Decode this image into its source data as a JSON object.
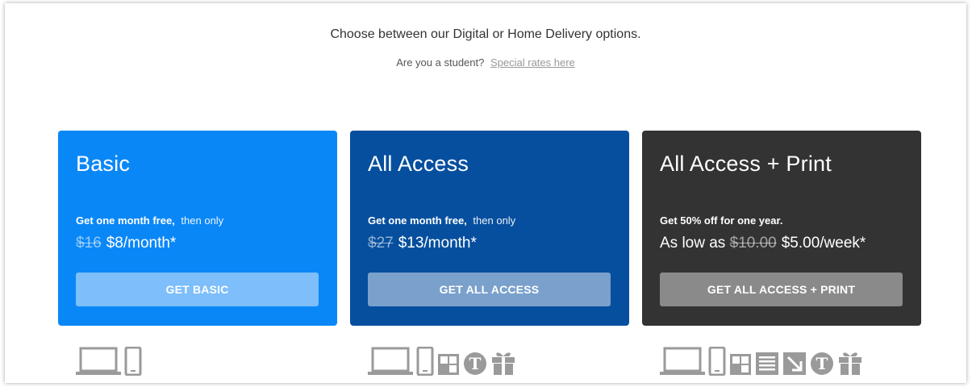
{
  "header": {
    "intro": "Choose between our Digital or Home Delivery options.",
    "student_prompt": "Are you a student?",
    "student_link": "Special rates here"
  },
  "plans": [
    {
      "title": "Basic",
      "offer_bold": "Get one month free,",
      "offer_rest": "then only",
      "old_price": "$16",
      "price": "$8/month*",
      "cta": "GET BASIC",
      "color": "#0a87f7",
      "icons": [
        "laptop-icon",
        "phone-icon"
      ]
    },
    {
      "title": "All Access",
      "offer_bold": "Get one month free,",
      "offer_rest": "then only",
      "old_price": "$27",
      "price": "$13/month*",
      "cta": "GET ALL ACCESS",
      "color": "#064f9f",
      "icons": [
        "laptop-icon",
        "phone-icon",
        "crossword-icon",
        "nyt-logo-icon",
        "gift-icon"
      ]
    },
    {
      "title": "All Access + Print",
      "offer_bold": "Get 50% off for one year.",
      "offer_rest": "",
      "price_prefix": "As low as",
      "old_price": "$10.00",
      "price": "$5.00/week*",
      "cta": "GET ALL ACCESS + PRINT",
      "color": "#333333",
      "icons": [
        "laptop-icon",
        "phone-icon",
        "crossword-icon",
        "newspaper-icon",
        "replica-icon",
        "nyt-logo-icon",
        "gift-icon"
      ]
    }
  ]
}
